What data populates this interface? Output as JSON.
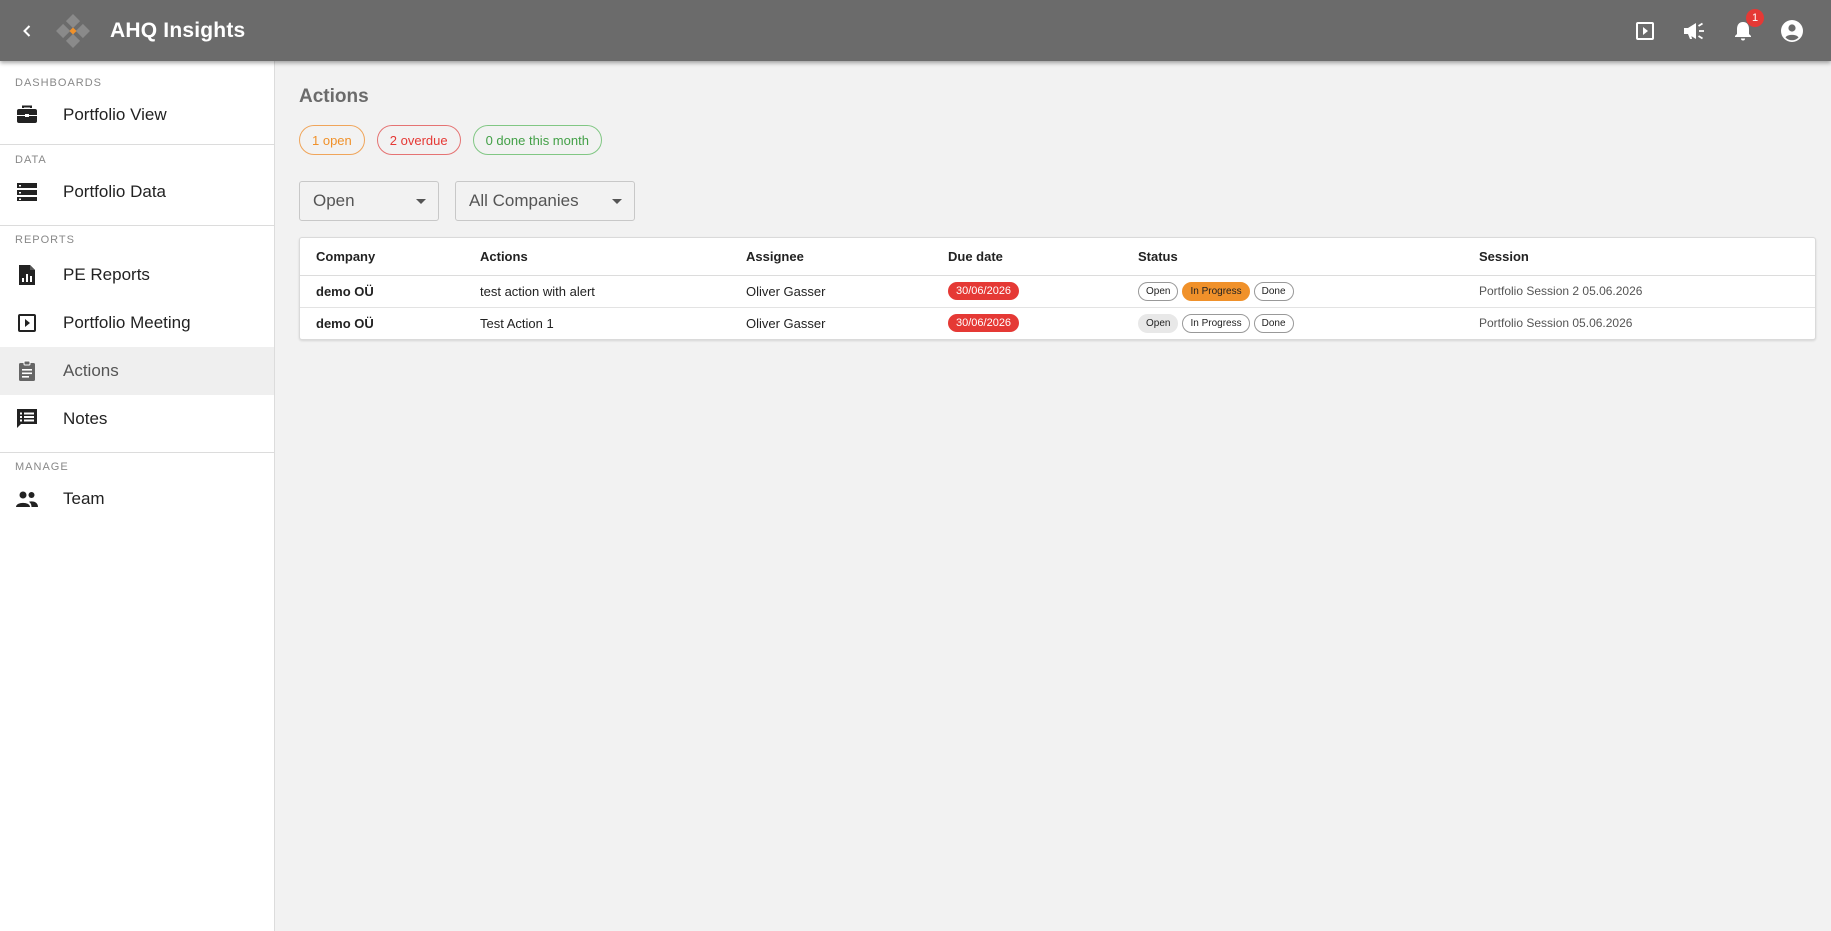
{
  "app": {
    "title": "AHQ Insights",
    "notification_count": "1",
    "colors": {
      "appbar": "#6b6b6b",
      "logo_accent": "#f0912a",
      "overdue_red": "#e53935",
      "in_progress_orange": "#f0912a",
      "done_green": "#43a047"
    }
  },
  "header_icons": [
    "back-arrow-icon",
    "presentation-play-icon",
    "megaphone-icon",
    "bell-icon",
    "account-circle-icon"
  ],
  "sidebar": {
    "sections": [
      {
        "label": "DASHBOARDS",
        "items": [
          {
            "label": "Portfolio View",
            "icon": "briefcase-icon"
          }
        ]
      },
      {
        "label": "DATA",
        "items": [
          {
            "label": "Portfolio Data",
            "icon": "storage-icon"
          }
        ]
      },
      {
        "label": "REPORTS",
        "items": [
          {
            "label": "PE Reports",
            "icon": "file-chart-icon"
          },
          {
            "label": "Portfolio Meeting",
            "icon": "slideshow-icon"
          },
          {
            "label": "Actions",
            "icon": "clipboard-icon",
            "active": true
          },
          {
            "label": "Notes",
            "icon": "chat-list-icon"
          }
        ]
      },
      {
        "label": "MANAGE",
        "items": [
          {
            "label": "Team",
            "icon": "people-icon"
          }
        ]
      }
    ]
  },
  "main": {
    "title": "Actions",
    "chips": {
      "open": "1 open",
      "overdue": "2 overdue",
      "done": "0 done this month"
    },
    "filters": {
      "status": "Open",
      "company": "All Companies"
    },
    "table": {
      "headers": [
        "Company",
        "Actions",
        "Assignee",
        "Due date",
        "Status",
        "Session"
      ],
      "status_options": [
        "Open",
        "In Progress",
        "Done"
      ],
      "rows": [
        {
          "company": "demo OÜ",
          "action": "test action with alert",
          "assignee": "Oliver Gasser",
          "due": "30/06/2026",
          "status": "In Progress",
          "session": "Portfolio Session 2 05.06.2026"
        },
        {
          "company": "demo OÜ",
          "action": "Test Action 1",
          "assignee": "Oliver Gasser",
          "due": "30/06/2026",
          "status": "Open",
          "session": "Portfolio Session 05.06.2026"
        }
      ]
    }
  }
}
